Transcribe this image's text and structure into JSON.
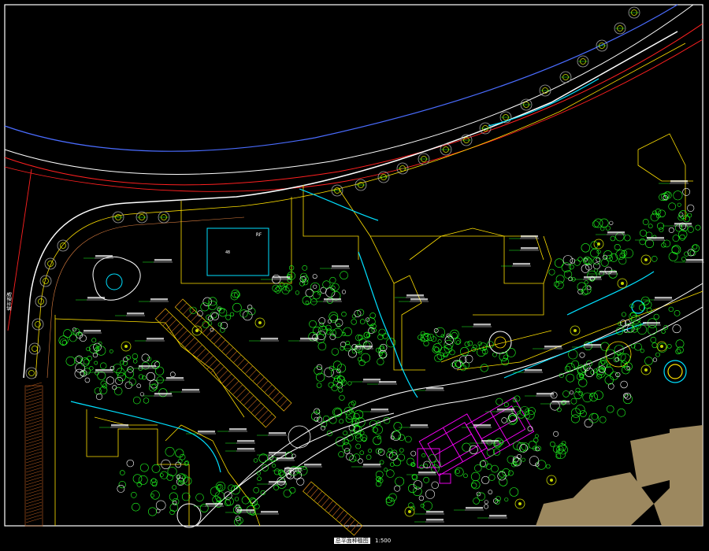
{
  "title_block": {
    "drawing_title": "总平面种植图",
    "scale": "1:500"
  },
  "road_labels": {
    "left_road": "城市道路",
    "bldg_tag": "RF"
  },
  "colors": {
    "background": "#000000",
    "frame": "#ffffff",
    "road_red": "#ff2020",
    "boundary_yellow": "#ffe000",
    "path_white": "#ffffff",
    "water_cyan": "#00e0ff",
    "court_magenta": "#ff00ff",
    "plant_green": "#20ff20",
    "tree_olive": "#c8d800",
    "building_tan": "#b8a070",
    "tree_gray": "#a0a0a0"
  },
  "icons": {
    "tree_symbol": "tree-circle-icon",
    "shrub_symbol": "shrub-cloud-icon",
    "leader_symbol": "leader-line-icon"
  }
}
